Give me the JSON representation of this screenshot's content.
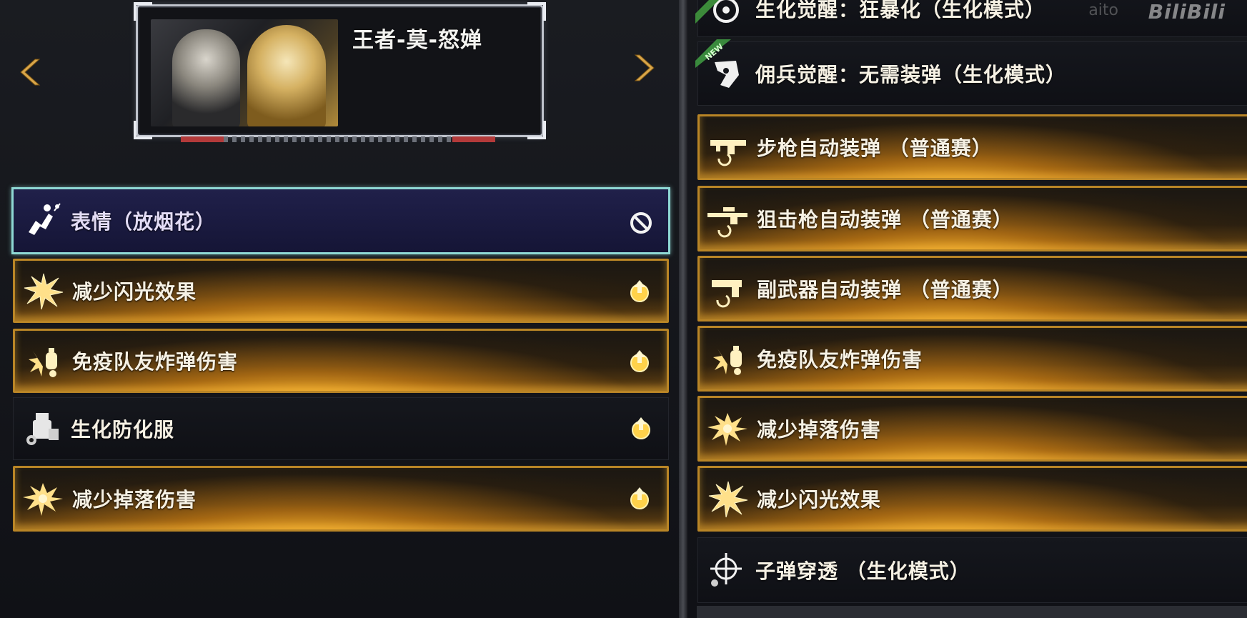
{
  "character": {
    "name": "王者-莫-怒婵"
  },
  "left_list": [
    {
      "label": "表情（放烟花）",
      "icon": "fireworks-emote-icon",
      "action_icon": "prohibit-icon",
      "style": "selected"
    },
    {
      "label": "减少闪光效果",
      "icon": "flash-burst-icon",
      "action_icon": "upgrade-icon",
      "style": "gold"
    },
    {
      "label": "免疫队友炸弹伤害",
      "icon": "grenade-burst-icon",
      "action_icon": "upgrade-icon",
      "style": "gold"
    },
    {
      "label": "生化防化服",
      "icon": "hazmat-suit-icon",
      "action_icon": "upgrade-icon",
      "style": "dark"
    },
    {
      "label": "减少掉落伤害",
      "icon": "fall-impact-icon",
      "action_icon": "upgrade-icon",
      "style": "gold"
    }
  ],
  "right_list": [
    {
      "label": "生化觉醒：狂暴化（生化模式）",
      "icon": "bio-awaken-icon",
      "style": "dark"
    },
    {
      "label": "佣兵觉醒：无需装弹（生化模式）",
      "icon": "mercenary-awaken-icon",
      "style": "dark",
      "badge": "NEW"
    },
    {
      "label": "步枪自动装弹 （普通赛）",
      "icon": "rifle-reload-icon",
      "style": "gold"
    },
    {
      "label": "狙击枪自动装弹 （普通赛）",
      "icon": "sniper-reload-icon",
      "style": "gold"
    },
    {
      "label": "副武器自动装弹 （普通赛）",
      "icon": "pistol-reload-icon",
      "style": "gold"
    },
    {
      "label": "免疫队友炸弹伤害",
      "icon": "grenade-burst-icon",
      "style": "gold"
    },
    {
      "label": "减少掉落伤害",
      "icon": "fall-impact-icon",
      "style": "gold"
    },
    {
      "label": "减少闪光效果",
      "icon": "flash-burst-icon",
      "style": "gold"
    },
    {
      "label": "子弹穿透 （生化模式）",
      "icon": "crosshair-penetration-icon",
      "style": "dark"
    }
  ],
  "watermark": {
    "text": "BiliBili",
    "partial": "aito"
  },
  "colors": {
    "gold_border": "#b98526",
    "selected_border": "#8ed8d4",
    "selected_bg": "#20204a",
    "panel_bg": "#15171c"
  }
}
